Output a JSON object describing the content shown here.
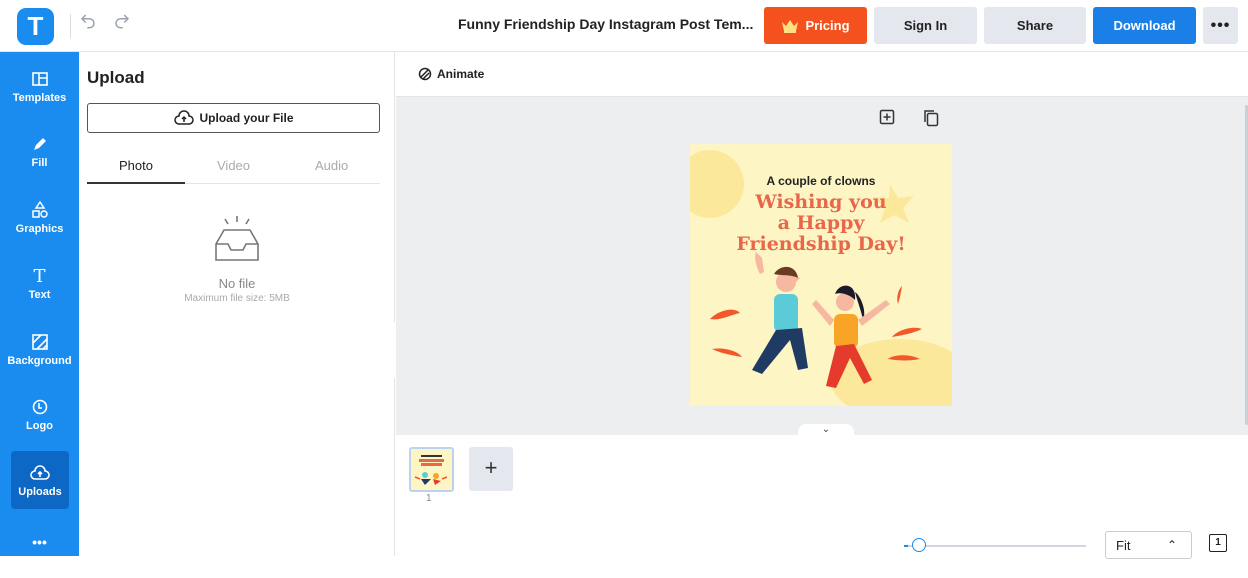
{
  "app": {
    "logo_letter": "T",
    "brand_color": "#1a8cf0"
  },
  "topbar": {
    "undo_icon": "undo-icon",
    "redo_icon": "redo-icon",
    "document_title": "Funny Friendship Day Instagram Post Tem...",
    "pricing_label": "Pricing",
    "signin_label": "Sign In",
    "share_label": "Share",
    "download_label": "Download",
    "more_label": "•••"
  },
  "sidebar": {
    "items": [
      {
        "label": "Templates",
        "icon": "templates-icon"
      },
      {
        "label": "Fill",
        "icon": "pencil-icon"
      },
      {
        "label": "Graphics",
        "icon": "shapes-icon"
      },
      {
        "label": "Text",
        "icon": "text-icon"
      },
      {
        "label": "Background",
        "icon": "background-icon"
      },
      {
        "label": "Logo",
        "icon": "logo-icon"
      },
      {
        "label": "Uploads",
        "icon": "upload-cloud-icon",
        "active": true
      },
      {
        "label": "More",
        "icon": "more-icon"
      }
    ]
  },
  "upload_panel": {
    "title": "Upload",
    "upload_button": "Upload your File",
    "tabs": [
      "Photo",
      "Video",
      "Audio"
    ],
    "active_tab": "Photo",
    "empty_title": "No file",
    "empty_subtitle": "Maximum file size: 5MB"
  },
  "workspace": {
    "animate_label": "Animate",
    "poster": {
      "subtitle": "A couple of clowns",
      "headline_1": "Wishing you",
      "headline_2": "a Happy",
      "headline_3": "Friendship Day!"
    }
  },
  "pages": {
    "current_page_number": "1",
    "add_page_label": "+",
    "zoom_mode": "Fit",
    "page_count": "1"
  }
}
